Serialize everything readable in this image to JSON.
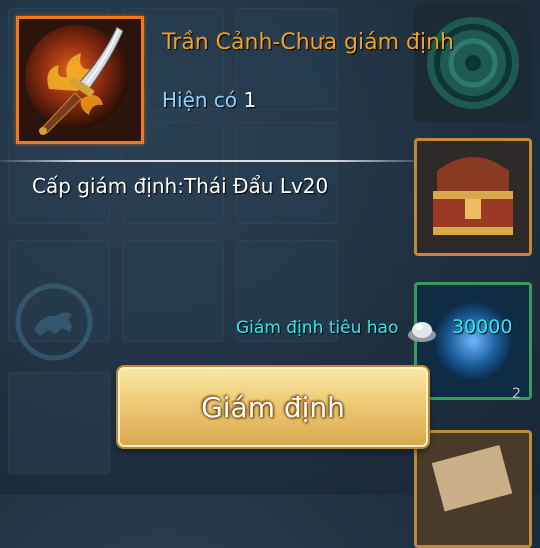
{
  "item": {
    "name": "Trần Cảnh-Chưa giám định",
    "owned_label": "Hiện có",
    "owned_count": "1",
    "icon": "flaming-sword-icon"
  },
  "requirement_text": "Cấp giám định:Thái Đẩu Lv20",
  "cost": {
    "label": "Giám định tiêu hao",
    "currency_icon": "silver-ingot-icon",
    "value": "30000"
  },
  "action_button": {
    "label": "Giám định"
  },
  "inventory": {
    "right_slots": [
      "jade-orb-icon",
      "treasure-chest-icon",
      "blue-orb-icon",
      "scroll-icon"
    ],
    "partial_count": "2"
  },
  "colors": {
    "item_name": "#f0a02a",
    "owned_label": "#8fd0ff",
    "cost_text": "#35e6ef",
    "item_border": "#f07a1a",
    "button": "#f0cd7a"
  }
}
